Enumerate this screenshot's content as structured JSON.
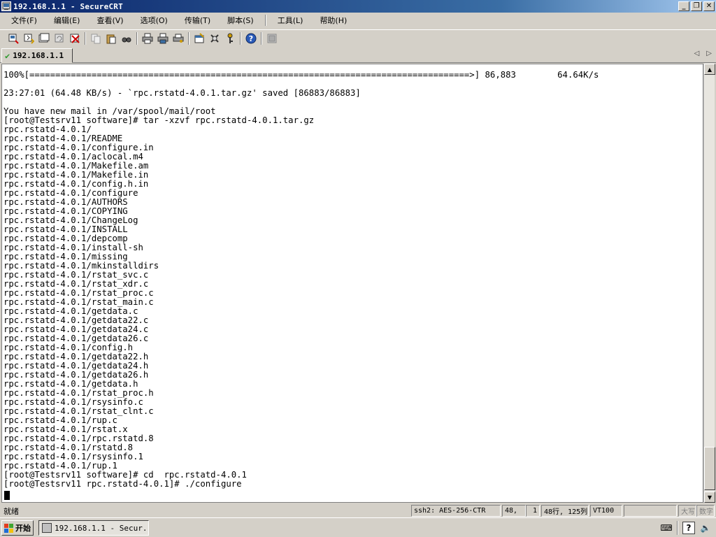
{
  "window": {
    "title": "192.168.1.1 - SecureCRT",
    "minimize_label": "_",
    "restore_label": "❐",
    "close_label": "✕"
  },
  "menu": [
    "文件(F)",
    "编辑(E)",
    "查看(V)",
    "选项(O)",
    "传输(T)",
    "脚本(S)",
    "工具(L)",
    "帮助(H)"
  ],
  "toolbar": {
    "groups": [
      [
        "connect-icon",
        "quick-connect-icon",
        "connect-tab-icon",
        "reconnect-icon",
        "disconnect-icon"
      ],
      [
        "copy-icon",
        "paste-icon",
        "find-icon"
      ],
      [
        "print-icon",
        "print-selection-icon",
        "print-setup-icon"
      ],
      [
        "session-options-icon",
        "global-options-icon",
        "key-icon"
      ],
      [
        "help-icon"
      ],
      [
        "log-icon"
      ]
    ]
  },
  "tab": {
    "check": "✔",
    "label": "192.168.1.1",
    "prev": "◁",
    "next": "▷"
  },
  "terminal": {
    "lines": [
      "100%[=====================================================================================>] 86,883        64.64K/s",
      "",
      "23:27:01 (64.48 KB/s) - `rpc.rstatd-4.0.1.tar.gz' saved [86883/86883]",
      "",
      "You have new mail in /var/spool/mail/root",
      "[root@Testsrv11 software]# tar -xzvf rpc.rstatd-4.0.1.tar.gz",
      "rpc.rstatd-4.0.1/",
      "rpc.rstatd-4.0.1/README",
      "rpc.rstatd-4.0.1/configure.in",
      "rpc.rstatd-4.0.1/aclocal.m4",
      "rpc.rstatd-4.0.1/Makefile.am",
      "rpc.rstatd-4.0.1/Makefile.in",
      "rpc.rstatd-4.0.1/config.h.in",
      "rpc.rstatd-4.0.1/configure",
      "rpc.rstatd-4.0.1/AUTHORS",
      "rpc.rstatd-4.0.1/COPYING",
      "rpc.rstatd-4.0.1/ChangeLog",
      "rpc.rstatd-4.0.1/INSTALL",
      "rpc.rstatd-4.0.1/depcomp",
      "rpc.rstatd-4.0.1/install-sh",
      "rpc.rstatd-4.0.1/missing",
      "rpc.rstatd-4.0.1/mkinstalldirs",
      "rpc.rstatd-4.0.1/rstat_svc.c",
      "rpc.rstatd-4.0.1/rstat_xdr.c",
      "rpc.rstatd-4.0.1/rstat_proc.c",
      "rpc.rstatd-4.0.1/rstat_main.c",
      "rpc.rstatd-4.0.1/getdata.c",
      "rpc.rstatd-4.0.1/getdata22.c",
      "rpc.rstatd-4.0.1/getdata24.c",
      "rpc.rstatd-4.0.1/getdata26.c",
      "rpc.rstatd-4.0.1/config.h",
      "rpc.rstatd-4.0.1/getdata22.h",
      "rpc.rstatd-4.0.1/getdata24.h",
      "rpc.rstatd-4.0.1/getdata26.h",
      "rpc.rstatd-4.0.1/getdata.h",
      "rpc.rstatd-4.0.1/rstat_proc.h",
      "rpc.rstatd-4.0.1/rsysinfo.c",
      "rpc.rstatd-4.0.1/rstat_clnt.c",
      "rpc.rstatd-4.0.1/rup.c",
      "rpc.rstatd-4.0.1/rstat.x",
      "rpc.rstatd-4.0.1/rpc.rstatd.8",
      "rpc.rstatd-4.0.1/rstatd.8",
      "rpc.rstatd-4.0.1/rsysinfo.1",
      "rpc.rstatd-4.0.1/rup.1",
      "[root@Testsrv11 software]# cd  rpc.rstatd-4.0.1",
      "[root@Testsrv11 rpc.rstatd-4.0.1]# ./configure"
    ]
  },
  "scrollbar": {
    "up": "▲",
    "down": "▼"
  },
  "status": {
    "text": "就绪",
    "cipher": "ssh2: AES-256-CTR",
    "row": "48,",
    "col": "1",
    "size": "48行, 125列",
    "emulation": "VT100",
    "blank": "",
    "caps": "大写",
    "num": "数字"
  },
  "taskbar": {
    "start_label": "开始",
    "task_label": "192.168.1.1 - Secur...",
    "tray_keyboard": "⌨",
    "tray_help": "?",
    "tray_speaker": "🔈"
  },
  "colors": {
    "titlebar_start": "#0a246a",
    "titlebar_end": "#a6caf0",
    "chrome": "#d4d0c8",
    "terminal_bg": "#ffffff"
  }
}
